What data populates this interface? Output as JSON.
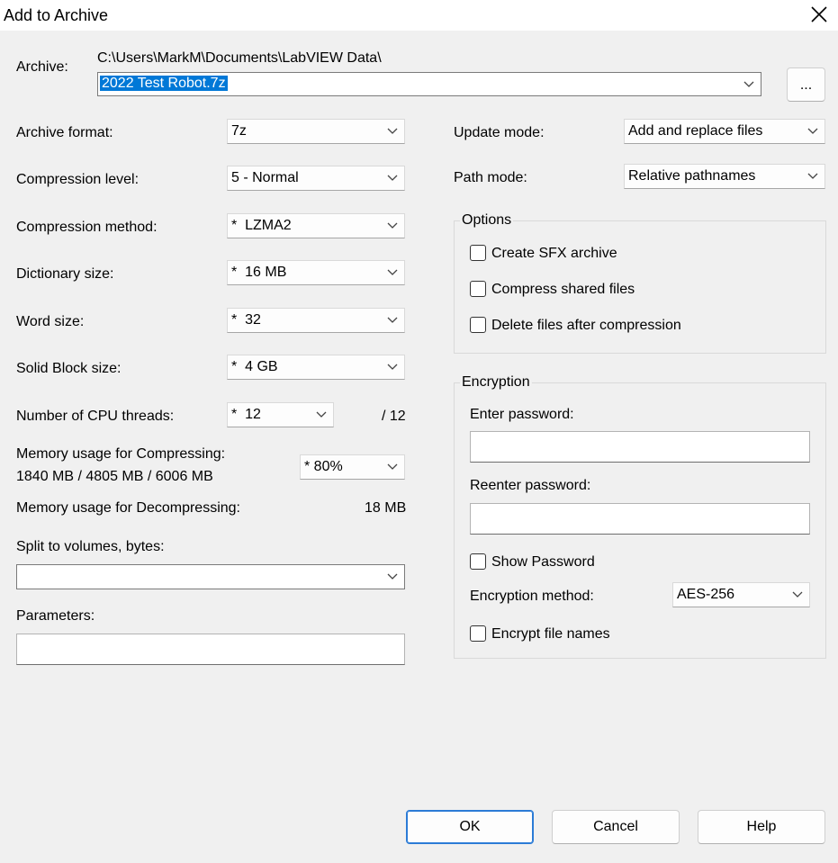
{
  "window": {
    "title": "Add to Archive"
  },
  "archive": {
    "label": "Archive:",
    "path": "C:\\Users\\MarkM\\Documents\\LabVIEW Data\\",
    "filename": "2022 Test Robot.7z",
    "browse_label": "..."
  },
  "left": {
    "format_label": "Archive format:",
    "format_value": "7z",
    "level_label": "Compression level:",
    "level_value": "5 - Normal",
    "method_label": "Compression method:",
    "method_value": "*  LZMA2",
    "dict_label": "Dictionary size:",
    "dict_value": "*  16 MB",
    "word_label": "Word size:",
    "word_value": "*  32",
    "solid_label": "Solid Block size:",
    "solid_value": "*  4 GB",
    "threads_label": "Number of CPU threads:",
    "threads_value": "*  12",
    "threads_max": "/ 12",
    "mem_comp_label": "Memory usage for Compressing:",
    "mem_comp_values": "1840 MB / 4805 MB / 6006 MB",
    "mem_comp_select": "* 80%",
    "mem_decomp_label": "Memory usage for Decompressing:",
    "mem_decomp_value": "18 MB",
    "split_label": "Split to volumes, bytes:",
    "split_value": "",
    "params_label": "Parameters:",
    "params_value": ""
  },
  "right": {
    "update_label": "Update mode:",
    "update_value": "Add and replace files",
    "path_label": "Path mode:",
    "path_value": "Relative pathnames",
    "options": {
      "title": "Options",
      "sfx": "Create SFX archive",
      "shared": "Compress shared files",
      "delete": "Delete files after compression"
    },
    "encryption": {
      "title": "Encryption",
      "enter_label": "Enter password:",
      "reenter_label": "Reenter password:",
      "show_label": "Show Password",
      "method_label": "Encryption method:",
      "method_value": "AES-256",
      "names_label": "Encrypt file names"
    }
  },
  "buttons": {
    "ok": "OK",
    "cancel": "Cancel",
    "help": "Help"
  }
}
